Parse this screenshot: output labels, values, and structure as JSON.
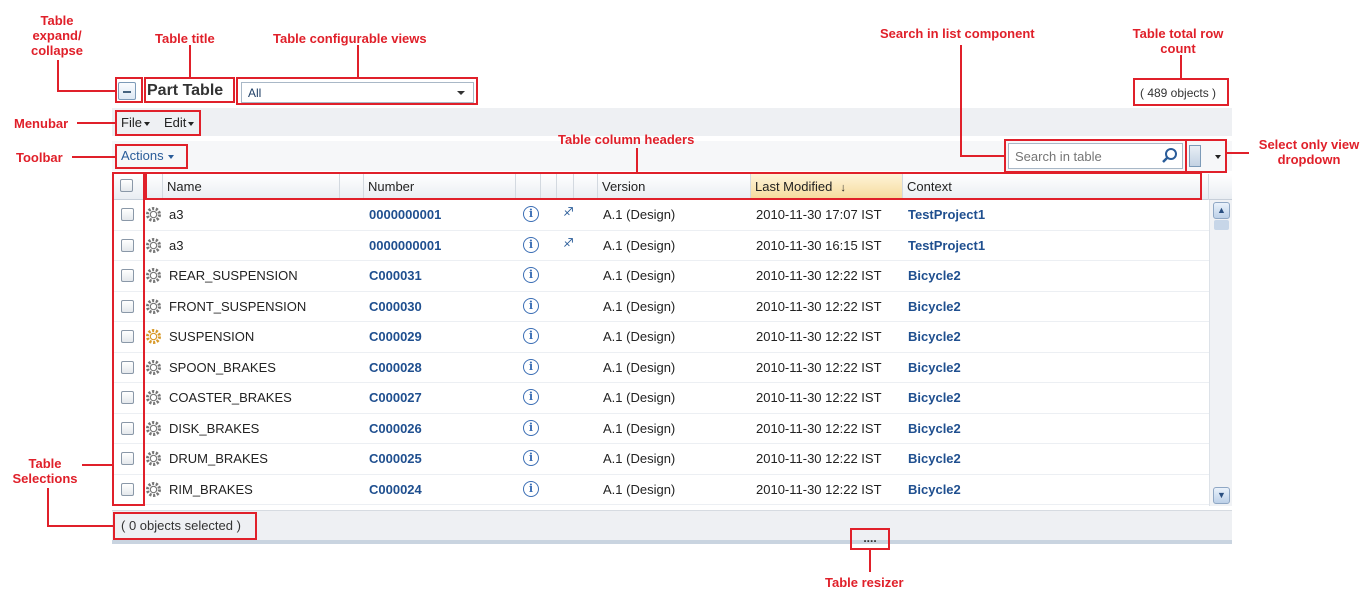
{
  "table": {
    "title": "Part Table",
    "view_selected": "All",
    "row_count": "( 489 objects )",
    "selected_count": "( 0 objects selected )",
    "search_placeholder": "Search in table",
    "resizer": "....",
    "menubar": {
      "file": "File",
      "edit": "Edit"
    },
    "toolbar": {
      "actions": "Actions"
    },
    "columns": {
      "name": "Name",
      "number": "Number",
      "version": "Version",
      "last_modified": "Last Modified",
      "context": "Context"
    },
    "rows": [
      {
        "name": "a3",
        "number": "0000000001",
        "version": "A.1 (Design)",
        "modified": "2010-11-30 17:07 IST",
        "context": "TestProject1",
        "extra_icon": "workflow-icon",
        "assembly": false
      },
      {
        "name": "a3",
        "number": "0000000001",
        "version": "A.1 (Design)",
        "modified": "2010-11-30 16:15 IST",
        "context": "TestProject1",
        "extra_icon": "workflow-icon",
        "assembly": false
      },
      {
        "name": "REAR_SUSPENSION",
        "number": "C000031",
        "version": "A.1 (Design)",
        "modified": "2010-11-30 12:22 IST",
        "context": "Bicycle2",
        "extra_icon": "",
        "assembly": false
      },
      {
        "name": "FRONT_SUSPENSION",
        "number": "C000030",
        "version": "A.1 (Design)",
        "modified": "2010-11-30 12:22 IST",
        "context": "Bicycle2",
        "extra_icon": "",
        "assembly": false
      },
      {
        "name": "SUSPENSION",
        "number": "C000029",
        "version": "A.1 (Design)",
        "modified": "2010-11-30 12:22 IST",
        "context": "Bicycle2",
        "extra_icon": "",
        "assembly": true
      },
      {
        "name": "SPOON_BRAKES",
        "number": "C000028",
        "version": "A.1 (Design)",
        "modified": "2010-11-30 12:22 IST",
        "context": "Bicycle2",
        "extra_icon": "",
        "assembly": false
      },
      {
        "name": "COASTER_BRAKES",
        "number": "C000027",
        "version": "A.1 (Design)",
        "modified": "2010-11-30 12:22 IST",
        "context": "Bicycle2",
        "extra_icon": "",
        "assembly": false
      },
      {
        "name": "DISK_BRAKES",
        "number": "C000026",
        "version": "A.1 (Design)",
        "modified": "2010-11-30 12:22 IST",
        "context": "Bicycle2",
        "extra_icon": "",
        "assembly": false
      },
      {
        "name": "DRUM_BRAKES",
        "number": "C000025",
        "version": "A.1 (Design)",
        "modified": "2010-11-30 12:22 IST",
        "context": "Bicycle2",
        "extra_icon": "",
        "assembly": false
      },
      {
        "name": "RIM_BRAKES",
        "number": "C000024",
        "version": "A.1 (Design)",
        "modified": "2010-11-30 12:22 IST",
        "context": "Bicycle2",
        "extra_icon": "",
        "assembly": false
      }
    ]
  },
  "callouts": {
    "expand_collapse": "Table\nexpand/\ncollapse",
    "title": "Table title",
    "views": "Table configurable views",
    "search": "Search in list component",
    "row_count": "Table total row\ncount",
    "menubar": "Menubar",
    "toolbar": "Toolbar",
    "column_headers": "Table column headers",
    "select_only_view": "Select only view\ndropdown",
    "selections": "Table\nSelections",
    "resizer": "Table resizer"
  },
  "colors": {
    "annotation": "#e0202a",
    "link": "#1f4f8f",
    "sorted_header": "#f5d99a"
  }
}
